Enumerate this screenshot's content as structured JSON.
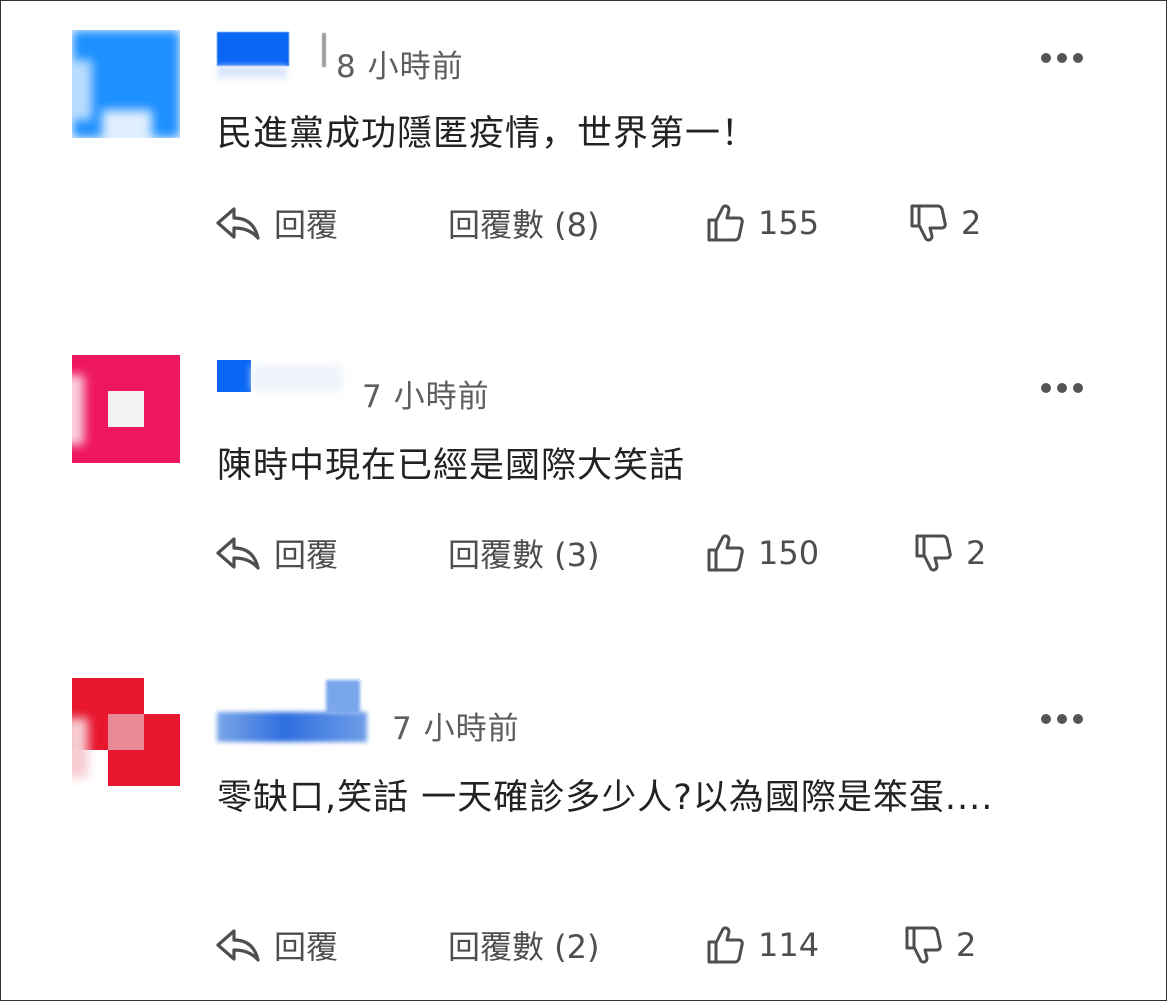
{
  "comments": [
    {
      "time": "8 小時前",
      "text": "民進黨成功隱匿疫情，世界第一！",
      "reply_label": "回覆",
      "reply_count_label": "回覆數 (8)",
      "likes": "155",
      "dislikes": "2"
    },
    {
      "time": "7 小時前",
      "text": "陳時中現在已經是國際大笑話",
      "reply_label": "回覆",
      "reply_count_label": "回覆數 (3)",
      "likes": "150",
      "dislikes": "2"
    },
    {
      "time": "7 小時前",
      "text": "零缺口,笑話 一天確診多少人?以為國際是笨蛋....",
      "reply_label": "回覆",
      "reply_count_label": "回覆數 (2)",
      "likes": "114",
      "dislikes": "2"
    }
  ],
  "colors": {
    "avatar1": "#1e90ff",
    "avatar2": "#ef1660",
    "avatar3": "#e8172f",
    "name_blot": "#0a66f5",
    "text": "#222222",
    "meta": "#5e5e5e"
  },
  "icons": {
    "reply": "reply-arrow-icon",
    "like": "thumbs-up-icon",
    "dislike": "thumbs-down-icon",
    "more": "more-dots-icon"
  }
}
